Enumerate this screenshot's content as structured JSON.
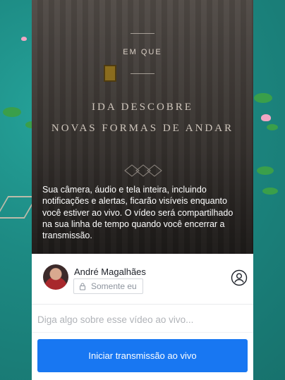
{
  "background": {
    "preview_subtitle": "EM QUE",
    "preview_headline_line1": "IDA DESCOBRE",
    "preview_headline_line2": "NOVAS FORMAS DE ANDAR"
  },
  "notice": {
    "text": "Sua câmera, áudio e tela inteira, incluindo notificações e alertas, ficarão visíveis enquanto você estiver ao vivo. O vídeo será compartilhado na sua linha de tempo quando você encerrar a transmissão."
  },
  "composer": {
    "user_name": "André Magalhães",
    "privacy_label": "Somente eu",
    "caption_placeholder": "Diga algo sobre esse vídeo ao vivo...",
    "go_live_label": "Iniciar transmissão ao vivo"
  },
  "icons": {
    "privacy": "lock-icon",
    "audience": "friends-icon"
  },
  "colors": {
    "accent": "#1877f2",
    "background": "#1f8f88"
  }
}
